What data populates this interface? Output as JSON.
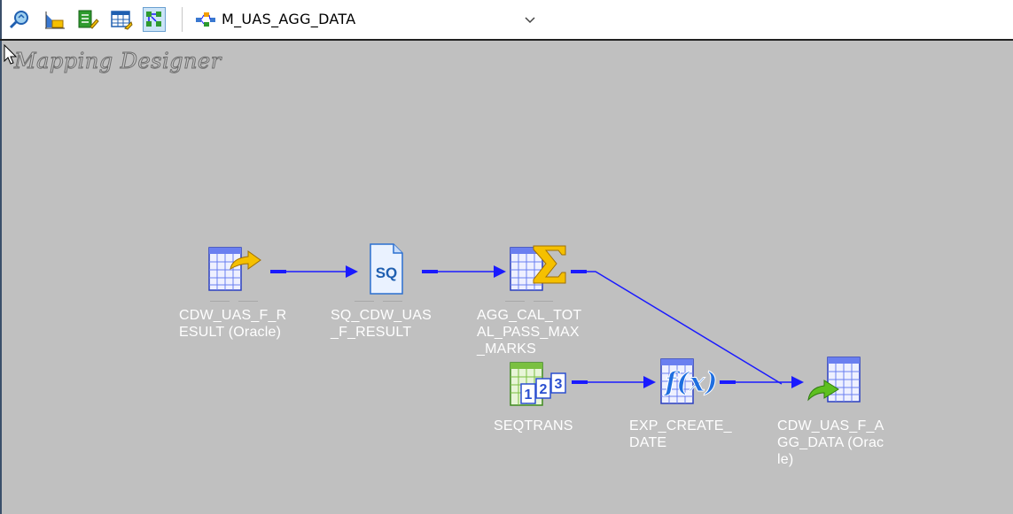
{
  "toolbar": {
    "buttons": [
      {
        "icon": "find-icon"
      },
      {
        "icon": "arrange-icon"
      },
      {
        "icon": "edit-list-icon"
      },
      {
        "icon": "table-grid-icon"
      },
      {
        "icon": "iconic-view-icon"
      }
    ],
    "mapping_select": {
      "icon": "mapping-icon",
      "value": "M_UAS_AGG_DATA"
    }
  },
  "canvas": {
    "title": "Mapping Designer",
    "nodes": [
      {
        "id": "source",
        "icon": "source-definition-icon",
        "label_lines": [
          "CDW_UAS_F_R",
          "ESULT (Oracle)"
        ]
      },
      {
        "id": "source-qualifier",
        "icon": "source-qualifier-icon",
        "label_lines": [
          "SQ_CDW_UAS",
          "_F_RESULT"
        ]
      },
      {
        "id": "aggregator",
        "icon": "aggregator-icon",
        "label_lines": [
          "AGG_CAL_TOT",
          "AL_PASS_MAX",
          "_MARKS"
        ]
      },
      {
        "id": "sequence",
        "icon": "sequence-generator-icon",
        "label_lines": [
          "SEQTRANS"
        ]
      },
      {
        "id": "expression",
        "icon": "expression-icon",
        "label_lines": [
          "EXP_CREATE_",
          "DATE"
        ]
      },
      {
        "id": "target",
        "icon": "target-definition-icon",
        "label_lines": [
          "CDW_UAS_F_A",
          "GG_DATA (Orac",
          "le)"
        ]
      }
    ],
    "colors": {
      "link": "#1a1aff",
      "canvas_bg": "#c0c0c0",
      "label": "#ffffff"
    }
  }
}
